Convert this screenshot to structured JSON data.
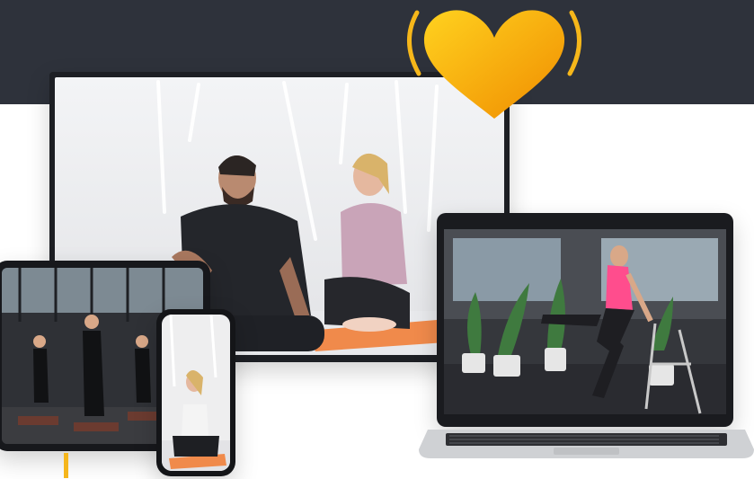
{
  "colors": {
    "top_band": "#2e323b",
    "heart_light": "#ffd21f",
    "heart_dark": "#f08c00",
    "mat": "#f08a4b",
    "top_pink": "#ff4d8d"
  },
  "icons": {
    "heart": "heart-icon",
    "tv": "tv-icon",
    "laptop": "laptop-icon",
    "tablet": "tablet-icon",
    "phone": "phone-icon"
  }
}
